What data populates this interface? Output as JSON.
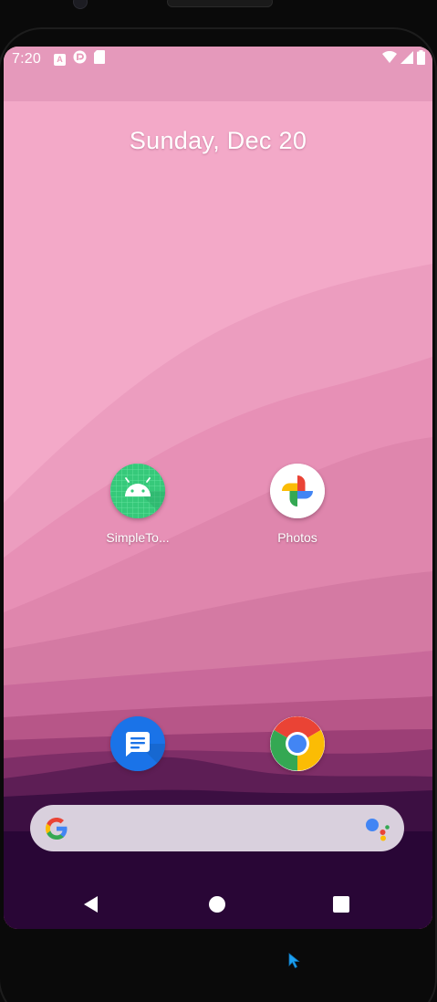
{
  "status_bar": {
    "time": "7:20",
    "notification_icons": [
      "a-box-icon",
      "pocket-casts-icon",
      "sd-card-icon"
    ],
    "notification_a_text": "A",
    "system_icons": [
      "wifi-icon",
      "cellular-signal-icon",
      "battery-icon"
    ]
  },
  "home": {
    "date": "Sunday, Dec 20"
  },
  "apps": [
    {
      "label": "SimpleTo...",
      "icon": "android-robot-icon",
      "color": "#3ddc84"
    },
    {
      "label": "Photos",
      "icon": "google-photos-pinwheel-icon",
      "color": "#ffffff"
    }
  ],
  "dock": [
    {
      "icon": "messages-icon",
      "color": "#1a73e8"
    },
    {
      "icon": "chrome-icon",
      "color": "#ffffff"
    }
  ],
  "search": {
    "g_icon": "google-g-icon",
    "assistant_icon": "google-assistant-icon",
    "background": "#d9d0dd"
  },
  "nav": {
    "back_icon": "back-triangle-icon",
    "home_icon": "home-circle-icon",
    "recents_icon": "recents-square-icon"
  },
  "theme": {
    "wallpaper_top": "#f2a7c6",
    "wallpaper_bottom": "#2a0a3a",
    "pointer": "#1da1f2"
  }
}
